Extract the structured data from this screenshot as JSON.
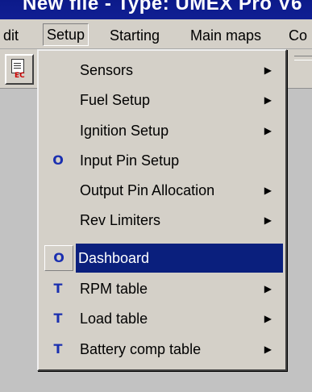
{
  "window": {
    "title": "New file - Type: UMEX Pro V6"
  },
  "menubar": {
    "items": [
      {
        "label": "dit",
        "mnemonic": ""
      },
      {
        "label": "Setup",
        "mnemonic": "S",
        "open": true
      },
      {
        "label": "Starting",
        "mnemonic": "a"
      },
      {
        "label": "Main maps",
        "mnemonic": "M"
      },
      {
        "label": "Co",
        "mnemonic": "C"
      }
    ]
  },
  "toolbar": {
    "button_icon": "document-ec-icon",
    "button_text": "EC"
  },
  "dropdown": {
    "items": [
      {
        "label": "Sensors",
        "icon": "",
        "submenu": true
      },
      {
        "label": "Fuel Setup",
        "icon": "",
        "submenu": true
      },
      {
        "label": "Ignition Setup",
        "icon": "",
        "submenu": true
      },
      {
        "label": "Input Pin Setup",
        "icon": "O",
        "submenu": false
      },
      {
        "label": "Output Pin Allocation",
        "icon": "",
        "submenu": true
      },
      {
        "label": "Rev Limiters",
        "icon": "",
        "submenu": true
      },
      {
        "label": "Dashboard",
        "icon": "O",
        "submenu": false,
        "selected": true
      },
      {
        "label": "RPM table",
        "icon": "T",
        "submenu": true
      },
      {
        "label": "Load table",
        "icon": "T",
        "submenu": true
      },
      {
        "label": "Battery comp table",
        "icon": "T",
        "submenu": true
      }
    ],
    "submenu_arrow": "▶"
  },
  "colors": {
    "highlight": "#0a1f7d",
    "icon_blue": "#1a2fb0",
    "menu_bg": "#d4d0c8"
  }
}
